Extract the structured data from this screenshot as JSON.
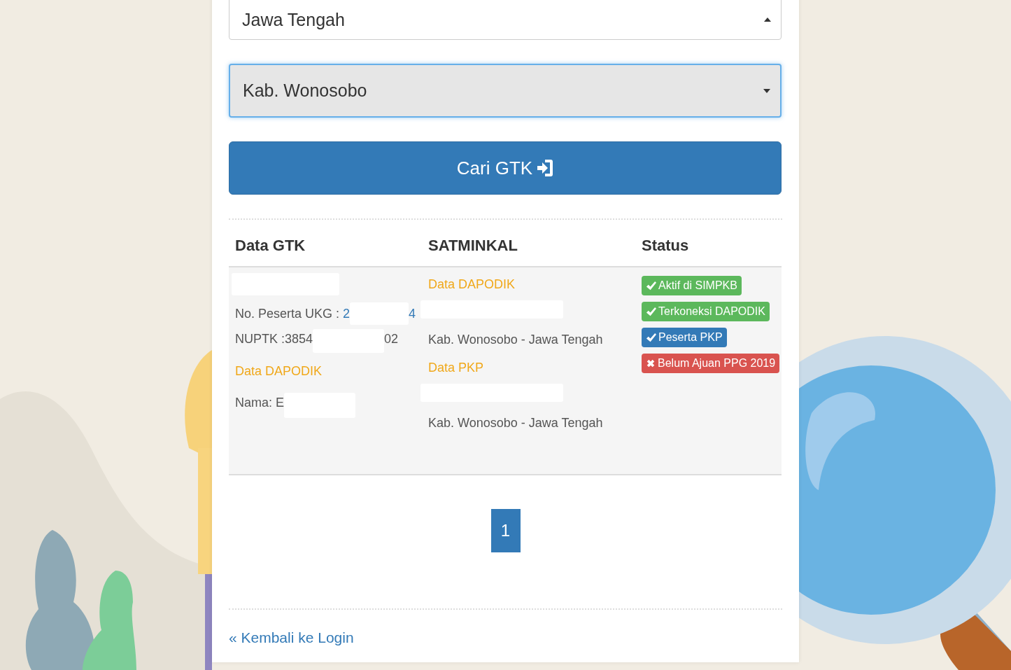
{
  "filters": [
    {
      "value": "Jawa Tengah",
      "focused": false
    },
    {
      "value": "Kab. Wonosobo",
      "focused": true
    }
  ],
  "search_button": {
    "label": "Cari GTK"
  },
  "table": {
    "columns": [
      "Data GTK",
      "SATMINKAL",
      "Status"
    ],
    "row": {
      "data_gtk": {
        "ukg_label": "No. Peserta UKG : ",
        "ukg_value_start": "2",
        "ukg_value_end": "4",
        "nuptk_start": "NUPTK :3854",
        "nuptk_end": "02",
        "dapodik_heading": "Data DAPODIK",
        "nama": "Nama: E"
      },
      "satminkal": [
        {
          "heading": "Data DAPODIK",
          "location": "Kab. Wonosobo - Jawa Tengah"
        },
        {
          "heading": "Data PKP",
          "location": "Kab. Wonosobo - Jawa Tengah"
        }
      ],
      "status": [
        {
          "label": "Aktif di SIMPKB",
          "kind": "success"
        },
        {
          "label": "Terkoneksi DAPODIK",
          "kind": "success"
        },
        {
          "label": "Peserta PKP",
          "kind": "primary"
        },
        {
          "label": "Belum Ajuan PPG 2019",
          "kind": "danger"
        }
      ]
    }
  },
  "pagination": [
    {
      "label": "1",
      "selected": true
    }
  ],
  "back_link": "« Kembali ke Login"
}
